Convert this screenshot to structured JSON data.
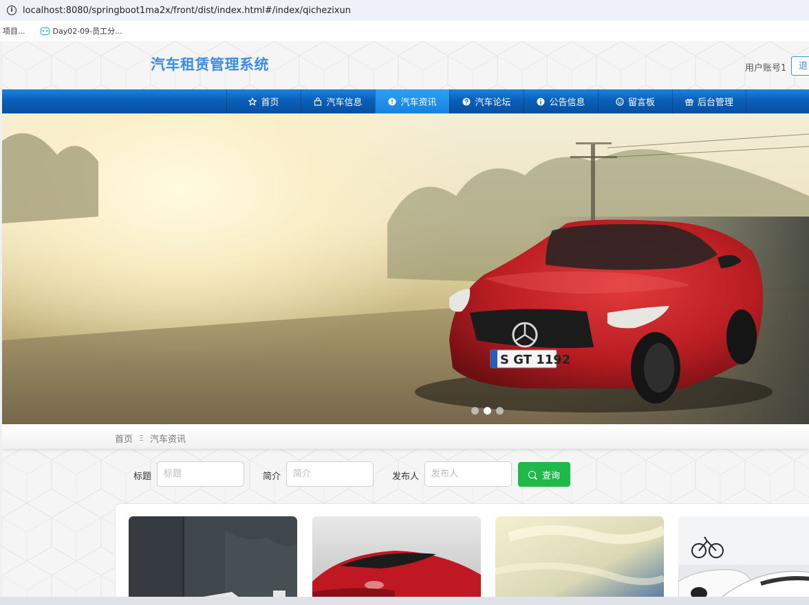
{
  "browser": {
    "url": "localhost:8080/springboot1ma2x/front/dist/index.html#/index/qichezixun",
    "bookmarks": [
      "项目...",
      "Day02-09-员工分..."
    ]
  },
  "header": {
    "title": "汽车租赁管理系统",
    "user_account": "用户账号1",
    "logout_label": "退"
  },
  "nav": {
    "items": [
      {
        "label": "首页",
        "icon": "star-icon"
      },
      {
        "label": "汽车信息",
        "icon": "bag-icon"
      },
      {
        "label": "汽车资讯",
        "icon": "info-circle-icon",
        "active": true
      },
      {
        "label": "汽车论坛",
        "icon": "question-circle-icon"
      },
      {
        "label": "公告信息",
        "icon": "info-icon"
      },
      {
        "label": "留言板",
        "icon": "smile-icon"
      },
      {
        "label": "后台管理",
        "icon": "gift-icon"
      }
    ]
  },
  "banner": {
    "plate_text": "S GT 1192",
    "active_slide": 2,
    "slide_count": 3
  },
  "breadcrumb": {
    "home": "首页",
    "separator": "Ξ",
    "current": "汽车资讯"
  },
  "search": {
    "title_label": "标题",
    "title_placeholder": "标题",
    "intro_label": "简介",
    "intro_placeholder": "简介",
    "publisher_label": "发布人",
    "publisher_placeholder": "发布人",
    "query_label": "查询"
  },
  "colors": {
    "brand_blue": "#3b8de8",
    "nav_blue": "#0a5fba",
    "query_green": "#1fb84a"
  }
}
